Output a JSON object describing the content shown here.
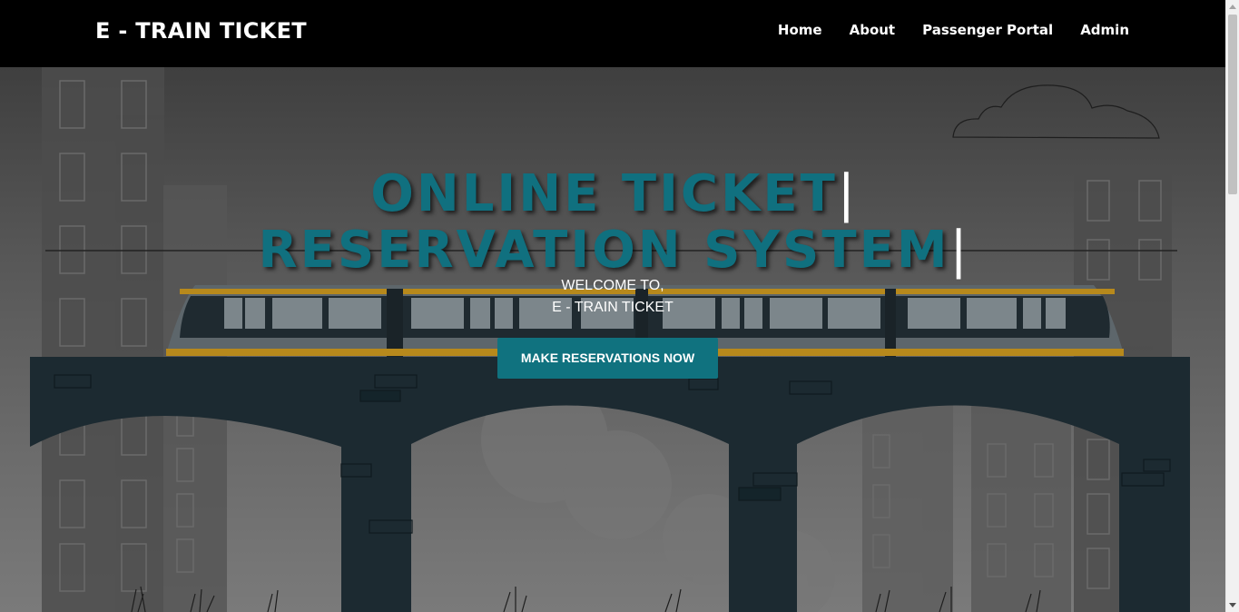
{
  "header": {
    "brand": "E - TRAIN TICKET",
    "nav": [
      {
        "label": "Home"
      },
      {
        "label": "About"
      },
      {
        "label": "Passenger Portal"
      },
      {
        "label": "Admin"
      }
    ]
  },
  "hero": {
    "title_line1": "ONLINE TICKET",
    "title_line2": "RESERVATION SYSTEM",
    "cursor": "|",
    "welcome_line1": "WELCOME TO,",
    "welcome_line2": "E - TRAIN TICKET",
    "cta_label": "MAKE RESERVATIONS NOW"
  },
  "colors": {
    "nav_background": "#000000",
    "accent": "#10727f",
    "bridge": "#1c2a31",
    "train_stripe": "#b7891c"
  },
  "icons": [
    "cloud-icon",
    "train-illustration",
    "bridge-illustration",
    "building-silhouette"
  ]
}
